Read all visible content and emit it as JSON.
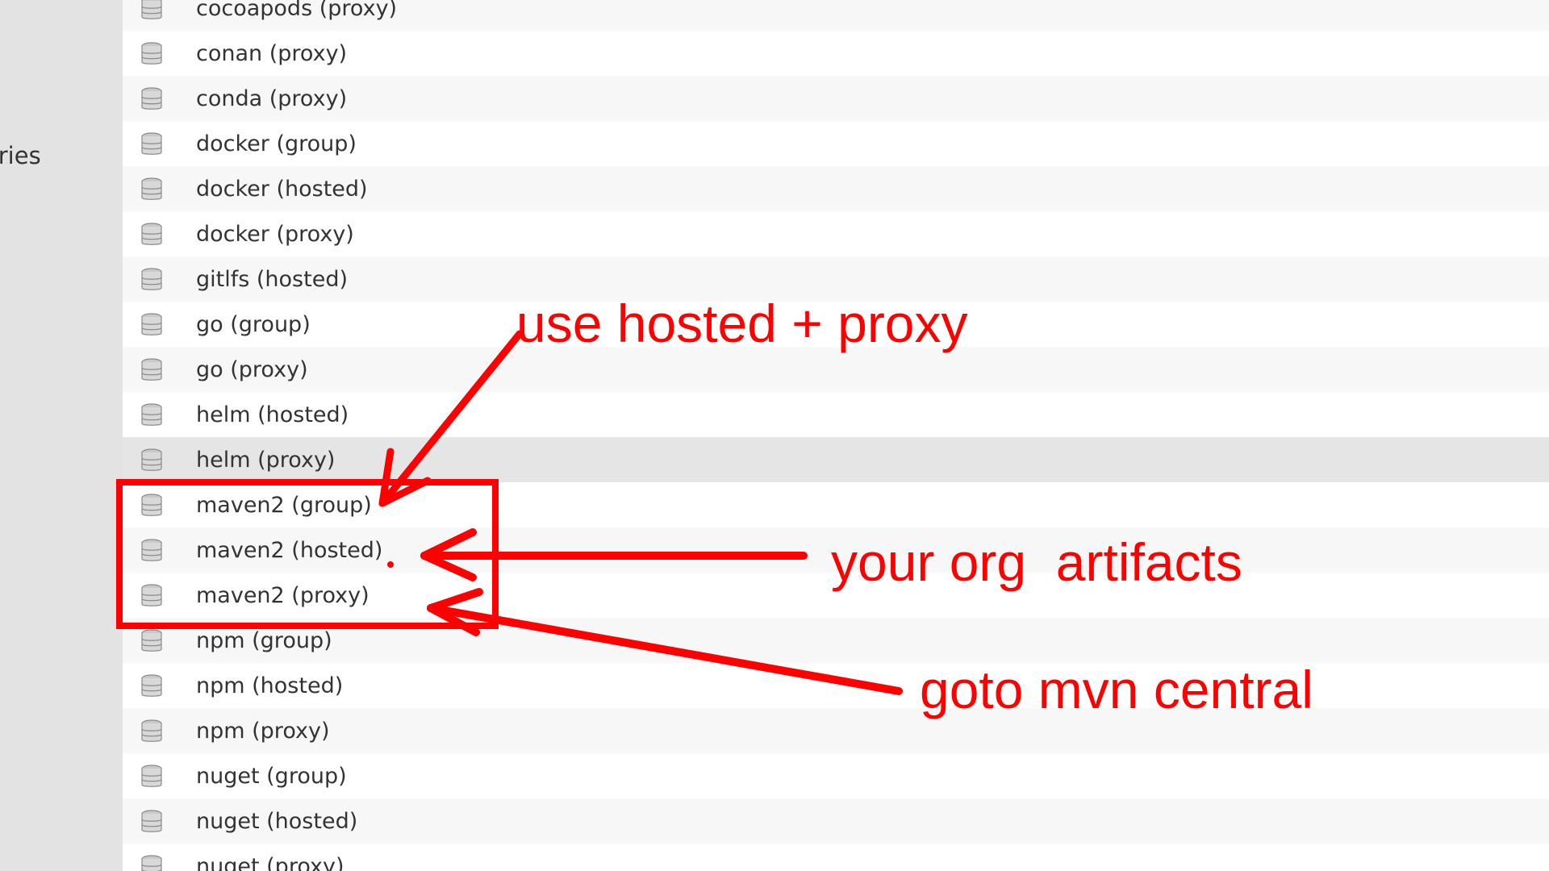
{
  "sidebar": {
    "partial_label": "ories"
  },
  "repositories": [
    {
      "name": "cocoapods (proxy)"
    },
    {
      "name": "conan (proxy)"
    },
    {
      "name": "conda (proxy)"
    },
    {
      "name": "docker (group)"
    },
    {
      "name": "docker (hosted)"
    },
    {
      "name": "docker (proxy)"
    },
    {
      "name": "gitlfs (hosted)"
    },
    {
      "name": "go (group)"
    },
    {
      "name": "go (proxy)"
    },
    {
      "name": "helm (hosted)"
    },
    {
      "name": "helm (proxy)"
    },
    {
      "name": "maven2 (group)"
    },
    {
      "name": "maven2 (hosted)"
    },
    {
      "name": "maven2 (proxy)"
    },
    {
      "name": "npm (group)"
    },
    {
      "name": "npm (hosted)"
    },
    {
      "name": "npm (proxy)"
    },
    {
      "name": "nuget (group)"
    },
    {
      "name": "nuget (hosted)"
    },
    {
      "name": "nuget (proxy)"
    }
  ],
  "icon": "database-icon",
  "annotations": {
    "color": "#ff0000",
    "use_hosted_proxy": "use hosted + proxy",
    "your_org_artifacts": "your org  artifacts",
    "goto_mvn_central": "goto mvn central"
  }
}
